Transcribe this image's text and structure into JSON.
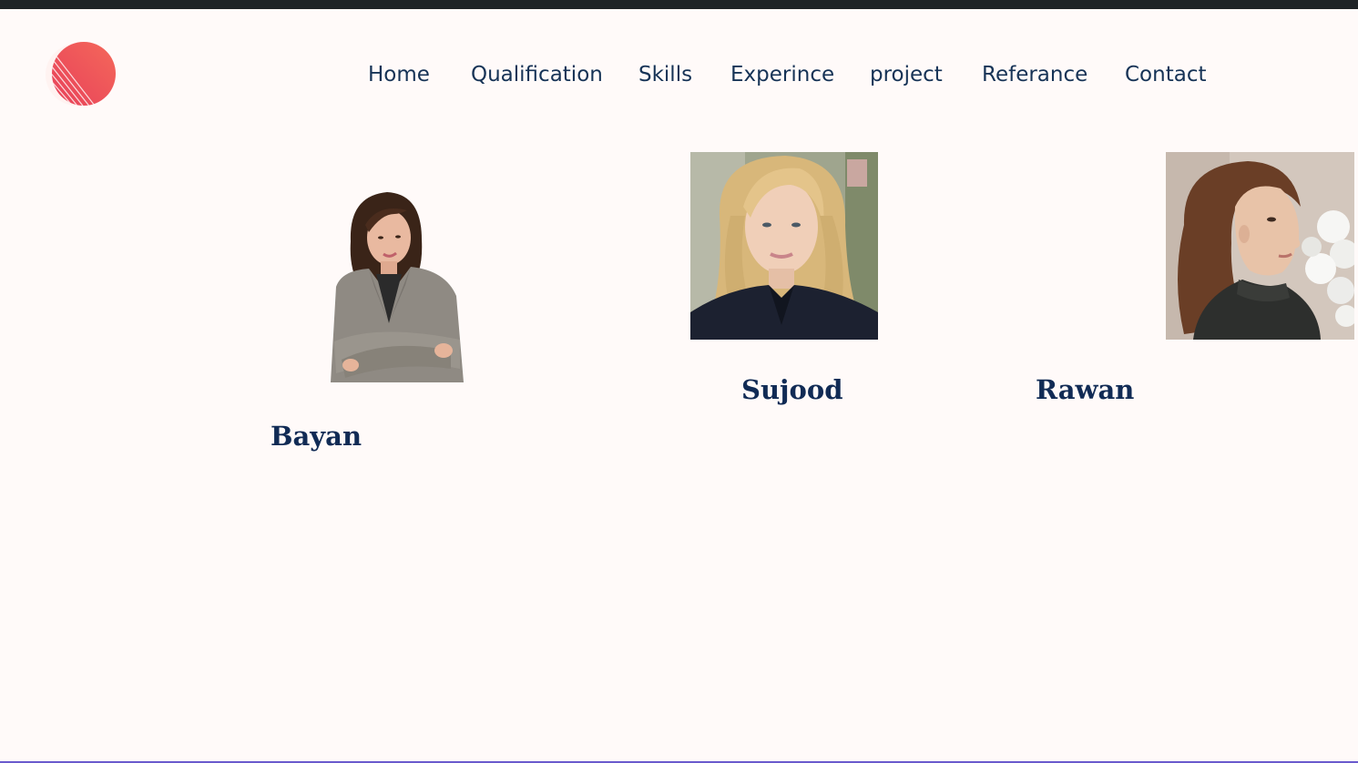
{
  "nav": {
    "items": [
      {
        "label": "Home"
      },
      {
        "label": "Qualification"
      },
      {
        "label": "Skills"
      },
      {
        "label": "Experince"
      },
      {
        "label": "project"
      },
      {
        "label": "Referance"
      },
      {
        "label": "Contact"
      }
    ]
  },
  "people": [
    {
      "name": "Bayan"
    },
    {
      "name": "Sujood"
    },
    {
      "name": "Rawan"
    }
  ],
  "colors": {
    "background": "#fffaf9",
    "nav_text": "#163356",
    "name_text": "#112b55",
    "logo_accent": "#ef5350",
    "top_strip": "#1f2326"
  },
  "icons": {
    "logo": "gradient-circle-logo-icon"
  }
}
